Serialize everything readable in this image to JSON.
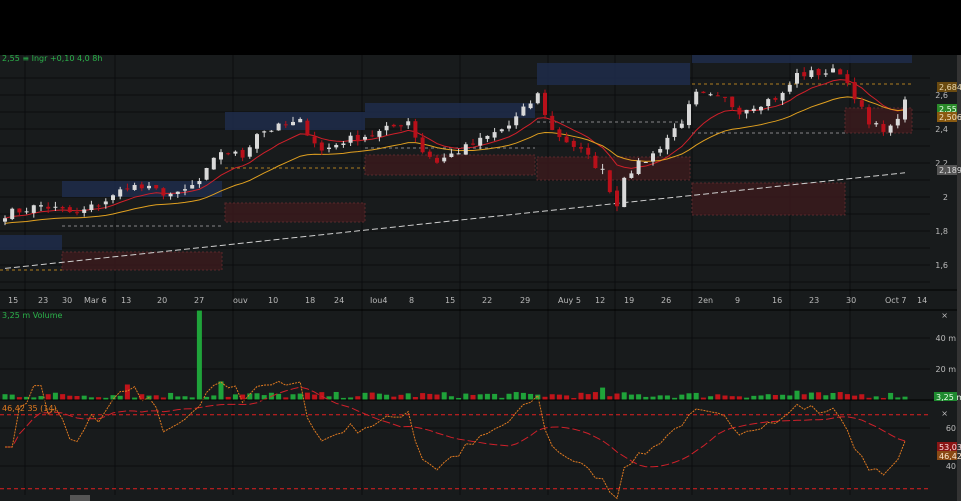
{
  "header": {
    "quote_line": "2,55 ≡ Ingr +0,10 4,0 8h"
  },
  "colors": {
    "up": "#1fa33a",
    "down": "#c0141a",
    "candle_up": "#d9d9d9",
    "candle_down": "#b8101a",
    "ema_fast": "#d0202a",
    "ema_slow": "#e0a020",
    "sma_long": "#cfcfcf",
    "rsi": "#e07a20",
    "rsi_signal": "#d0202a",
    "bg": "#181b1c"
  },
  "price_axis": {
    "ticks": [
      "2,6",
      "2,4",
      "2,2",
      "2",
      "1,8",
      "1,6"
    ],
    "badges": {
      "level_high": "2,684",
      "last": "2,55",
      "ema": "2,506",
      "sma": "2,189"
    }
  },
  "time_axis": {
    "labels": [
      "15",
      "23",
      "30",
      "Mar 6",
      "13",
      "20",
      "27",
      "ouv",
      "10",
      "18",
      "24",
      "Iou4",
      "8",
      "15",
      "22",
      "29",
      "Auy 5",
      "12",
      "19",
      "26",
      "2en",
      "9",
      "16",
      "23",
      "30",
      "Oct 7",
      "14"
    ]
  },
  "volume": {
    "title": "3,25 m Volume",
    "ticks": [
      "40 m",
      "20 m"
    ],
    "last": "3,25 m",
    "close_mark": "×"
  },
  "rsi": {
    "title": "46,42 35 (14)",
    "ticks": [
      "60",
      "40"
    ],
    "signal_value": "53,03",
    "rsi_value": "46,42",
    "close_mark": "×"
  },
  "chart_data": {
    "type": "candlestick",
    "bars": 126,
    "keypoints": [
      [
        0,
        1.9
      ],
      [
        5,
        1.95
      ],
      [
        10,
        1.9
      ],
      [
        15,
        2.0
      ],
      [
        17,
        2.07
      ],
      [
        24,
        2.01
      ],
      [
        27,
        2.09
      ],
      [
        30,
        2.27
      ],
      [
        33,
        2.24
      ],
      [
        35,
        2.38
      ],
      [
        41,
        2.44
      ],
      [
        44,
        2.27
      ],
      [
        47,
        2.33
      ],
      [
        52,
        2.38
      ],
      [
        56,
        2.45
      ],
      [
        58,
        2.27
      ],
      [
        60,
        2.21
      ],
      [
        66,
        2.33
      ],
      [
        70,
        2.42
      ],
      [
        74,
        2.6
      ],
      [
        76,
        2.39
      ],
      [
        80,
        2.27
      ],
      [
        83,
        2.15
      ],
      [
        85,
        1.95
      ],
      [
        86,
        2.13
      ],
      [
        90,
        2.25
      ],
      [
        94,
        2.45
      ],
      [
        96,
        2.6
      ],
      [
        100,
        2.57
      ],
      [
        102,
        2.51
      ],
      [
        108,
        2.6
      ],
      [
        110,
        2.72
      ],
      [
        116,
        2.74
      ],
      [
        118,
        2.6
      ],
      [
        120,
        2.42
      ],
      [
        123,
        2.4
      ],
      [
        125,
        2.55
      ]
    ],
    "volume_spikes_m": [
      [
        17,
        10
      ],
      [
        27,
        58
      ],
      [
        30,
        12
      ],
      [
        83,
        8
      ],
      [
        110,
        6
      ]
    ],
    "price_range": [
      1.55,
      2.85
    ],
    "volume_range_m": [
      0,
      60
    ],
    "rsi_range": [
      25,
      75
    ]
  }
}
